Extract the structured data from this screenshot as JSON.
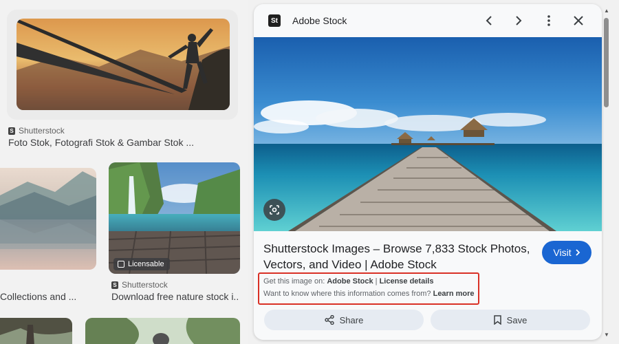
{
  "results": [
    {
      "source": "Shutterstock",
      "title": "Foto Stok, Fotografi Stok & Gambar Stok ..."
    },
    {
      "source": "",
      "title": "Collections and ..."
    },
    {
      "source": "Shutterstock",
      "title": "Download free nature stock i...",
      "badge": "Licensable"
    }
  ],
  "panel": {
    "site_name": "Adobe Stock",
    "site_logo_text": "St",
    "title": "Shutterstock Images – Browse 7,833 Stock Photos, Vectors, and Video | Adobe Stock",
    "visit_label": "Visit",
    "credit_prefix": "Get this image on:",
    "credit_source": "Adobe Stock",
    "credit_separator": "|",
    "credit_license": "License details",
    "credit_question": "Want to know where this information comes from?",
    "credit_learn": "Learn more",
    "share_label": "Share",
    "save_label": "Save"
  },
  "colors": {
    "accent": "#1a66d2",
    "highlight_box": "#d93025"
  },
  "icons": {
    "prev": "chevron-left-icon",
    "next": "chevron-right-icon",
    "more": "more-vert-icon",
    "close": "close-icon",
    "lens": "lens-icon",
    "share": "share-icon",
    "save": "bookmark-icon"
  }
}
